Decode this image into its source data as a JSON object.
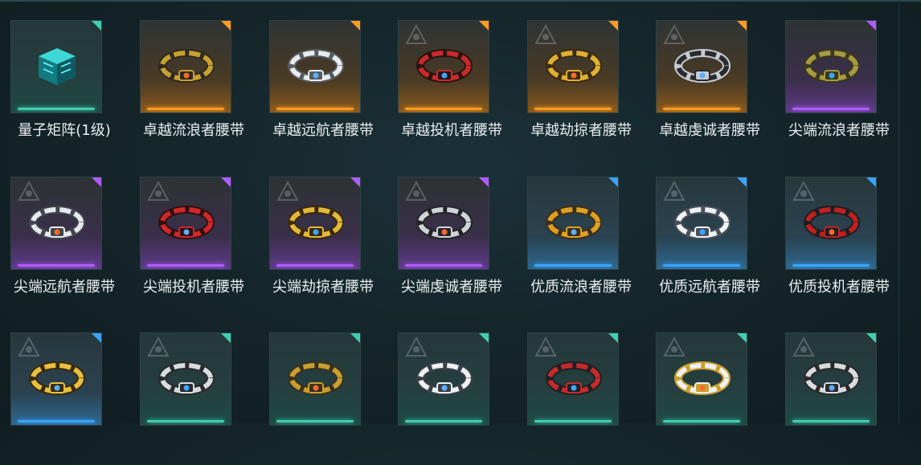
{
  "inventory": {
    "items": [
      {
        "name": "量子矩阵(1级)",
        "quality": "green",
        "icon": "quantum-matrix-cube-icon",
        "emblem": "none"
      },
      {
        "name": "卓越流浪者腰带",
        "quality": "orange",
        "icon": "belt-icon",
        "emblem": "none"
      },
      {
        "name": "卓越远航者腰带",
        "quality": "orange",
        "icon": "belt-icon",
        "emblem": "none"
      },
      {
        "name": "卓越投机者腰带",
        "quality": "orange",
        "icon": "belt-icon",
        "emblem": "insignia"
      },
      {
        "name": "卓越劫掠者腰带",
        "quality": "orange",
        "icon": "belt-icon",
        "emblem": "insignia"
      },
      {
        "name": "卓越虔诚者腰带",
        "quality": "orange",
        "icon": "belt-icon",
        "emblem": "insignia"
      },
      {
        "name": "尖端流浪者腰带",
        "quality": "purple",
        "icon": "belt-icon",
        "emblem": "none"
      },
      {
        "name": "尖端远航者腰带",
        "quality": "purple",
        "icon": "belt-icon",
        "emblem": "insignia"
      },
      {
        "name": "尖端投机者腰带",
        "quality": "purple",
        "icon": "belt-icon",
        "emblem": "insignia"
      },
      {
        "name": "尖端劫掠者腰带",
        "quality": "purple",
        "icon": "belt-icon",
        "emblem": "insignia"
      },
      {
        "name": "尖端虔诚者腰带",
        "quality": "purple",
        "icon": "belt-icon",
        "emblem": "insignia"
      },
      {
        "name": "优质流浪者腰带",
        "quality": "blue",
        "icon": "belt-icon",
        "emblem": "none"
      },
      {
        "name": "优质远航者腰带",
        "quality": "blue",
        "icon": "belt-icon",
        "emblem": "insignia"
      },
      {
        "name": "优质投机者腰带",
        "quality": "blue",
        "icon": "belt-icon",
        "emblem": "insignia"
      },
      {
        "name": "",
        "quality": "blue",
        "icon": "belt-icon",
        "emblem": "insignia"
      },
      {
        "name": "",
        "quality": "green",
        "icon": "belt-icon",
        "emblem": "insignia"
      },
      {
        "name": "",
        "quality": "green",
        "icon": "belt-icon",
        "emblem": "none"
      },
      {
        "name": "",
        "quality": "green",
        "icon": "belt-icon",
        "emblem": "insignia"
      },
      {
        "name": "",
        "quality": "green",
        "icon": "belt-icon",
        "emblem": "insignia"
      },
      {
        "name": "",
        "quality": "green",
        "icon": "belt-icon",
        "emblem": "insignia"
      },
      {
        "name": "",
        "quality": "green",
        "icon": "belt-icon",
        "emblem": "insignia"
      }
    ]
  },
  "colors": {
    "background": "#142428",
    "quality_green": "#3fd0b0",
    "quality_orange": "#ff9a22",
    "quality_purple": "#b15cff",
    "quality_blue": "#3aa4ff",
    "label": "#e9eef0"
  }
}
